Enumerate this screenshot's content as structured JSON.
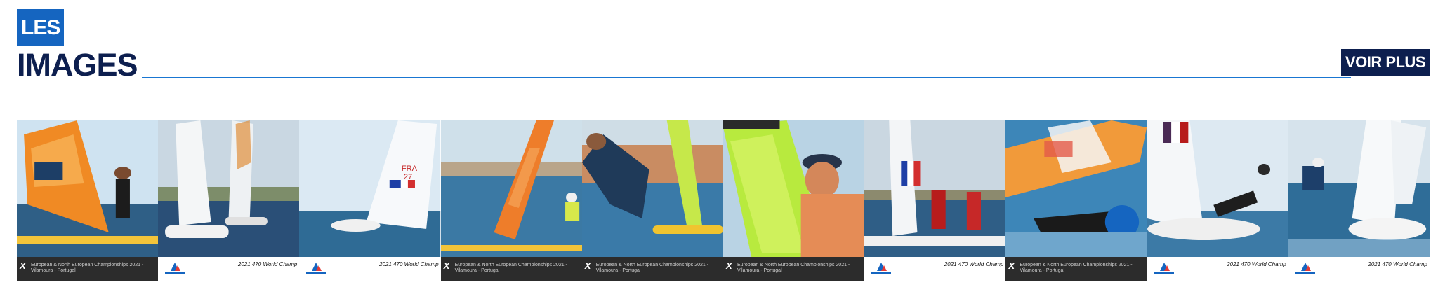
{
  "section": {
    "badge": "LES",
    "title": "IMAGES",
    "more_label": "VOIR PLUS"
  },
  "colors": {
    "brand_dark": "#0d1f4f",
    "accent": "#1565c0"
  },
  "captions": {
    "euro": "European & North European Championships 2021 - Vilamoura - Portugal",
    "worlds": "2021 470 World Champ"
  },
  "gallery": [
    {
      "name": "windsurfer-orange-sail",
      "caption": "euro"
    },
    {
      "name": "470-dinghies-white-sails",
      "caption": "worlds"
    },
    {
      "name": "470-fra-27",
      "caption": "worlds"
    },
    {
      "name": "windsurfer-orange-sail-2",
      "caption": "euro"
    },
    {
      "name": "windsurfer-yellow-sail",
      "caption": "euro"
    },
    {
      "name": "windsurfer-cap-closeup",
      "caption": "euro"
    },
    {
      "name": "470-crew-fra-flag",
      "caption": "worlds"
    },
    {
      "name": "windsurfer-crash",
      "caption": "euro"
    },
    {
      "name": "470-fra-flag-hiking",
      "caption": "worlds"
    },
    {
      "name": "470-spray",
      "caption": "worlds"
    }
  ]
}
